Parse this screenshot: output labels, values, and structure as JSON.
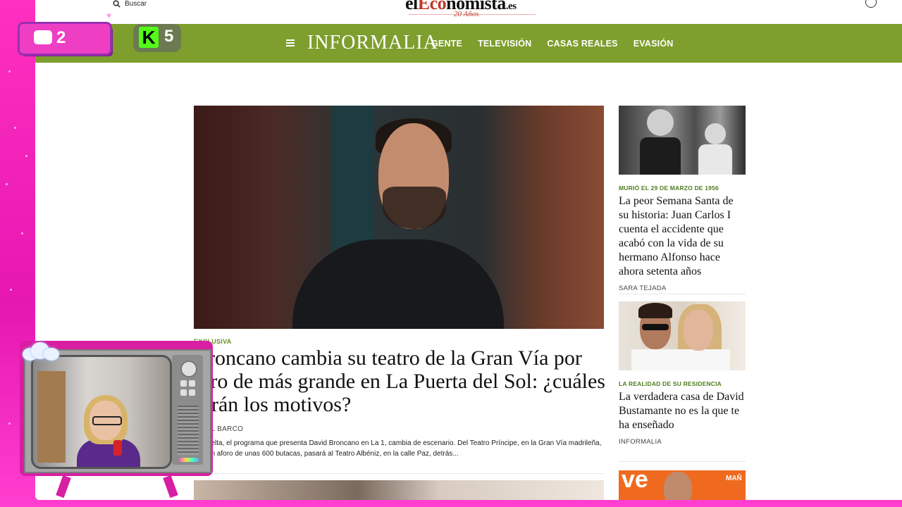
{
  "topbar": {
    "search_label": "Buscar",
    "logo_part1": "el",
    "logo_part2": "Eco",
    "logo_part3": "nomista",
    "logo_part4": ".es",
    "logo_sub": "20 Años"
  },
  "nav": {
    "brand": "INFORMALIA",
    "links": [
      "GENTE",
      "TELEVISIÓN",
      "CASAS REALES",
      "EVASIÓN"
    ]
  },
  "main_article": {
    "kicker": "EXCLUSIVA",
    "headline": "Broncano cambia su teatro de la Gran Vía por otro de más grande en La Puerta del Sol: ¿cuáles serán los motivos?",
    "byline": "S DEL BARCO",
    "summary": "La vuelta, el programa que presenta David Broncano en La 1, cambia de escenario. Del Teatro Príncipe, en la Gran Vía madrileña, con un aforo de unas 600 butacas, pasará al Teatro Albéniz, en la calle Paz, detrás..."
  },
  "sidebar": [
    {
      "kicker": "MURIÓ EL 29 DE MARZO DE 1956",
      "title": "La peor Semana Santa de su historia: Juan Carlos I cuenta el accidente que acabó con la vida de su hermano Alfonso hace ahora setenta años",
      "author": "SARA TEJADA"
    },
    {
      "kicker": "LA REALIDAD DE SU RESIDENCIA",
      "title": "La verdadera casa de David Bustamante no es la que te ha enseñado",
      "author": "INFORMALIA"
    },
    {
      "thumb_text_1": "ve",
      "thumb_text_2": "MAÑ"
    }
  ],
  "overlay": {
    "chat_count": "2",
    "kick_letter": "K",
    "kick_count": "5"
  },
  "colors": {
    "nav_green": "#7e9e2d",
    "kicker_green": "#4e7d1e",
    "stream_pink": "#ff2fb8"
  }
}
